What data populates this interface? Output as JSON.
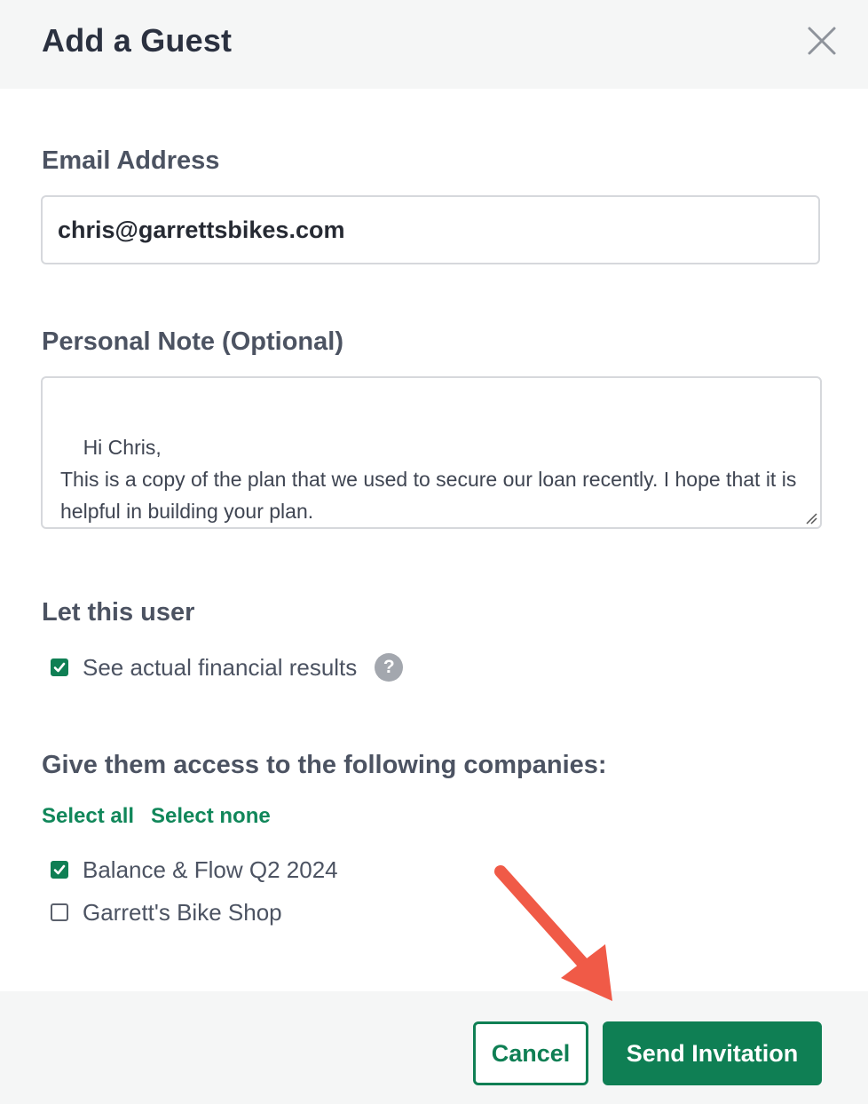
{
  "dialog": {
    "title": "Add a Guest",
    "close_icon": "close-icon"
  },
  "email": {
    "label": "Email Address",
    "value": "chris@garrettsbikes.com"
  },
  "note": {
    "label": "Personal Note (Optional)",
    "value": "Hi Chris,\nThis is a copy of the plan that we used to secure our loan recently. I hope that it is helpful in building your plan."
  },
  "permissions": {
    "heading": "Let this user",
    "items": [
      {
        "label": "See actual financial results",
        "checked": true,
        "help_icon": "question-icon",
        "help_text": "?"
      }
    ]
  },
  "companies": {
    "heading": "Give them access to the following companies:",
    "select_all": "Select all",
    "select_none": "Select none",
    "items": [
      {
        "label": "Balance & Flow Q2 2024",
        "checked": true
      },
      {
        "label": "Garrett's Bike Shop",
        "checked": false
      }
    ]
  },
  "footer": {
    "cancel_label": "Cancel",
    "send_label": "Send Invitation"
  },
  "colors": {
    "accent": "#0f7f54",
    "link": "#11875a",
    "annotation_arrow": "#f05a47",
    "header_bg": "#f5f6f6"
  }
}
